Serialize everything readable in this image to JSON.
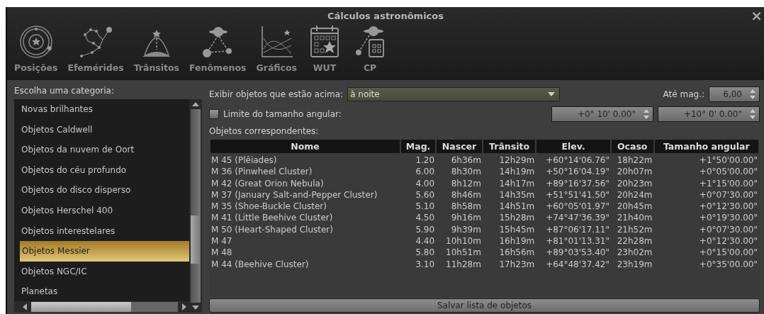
{
  "window": {
    "title": "Cálculos astronômicos",
    "close": "×"
  },
  "tabs": [
    {
      "label": "Posições",
      "selected": false
    },
    {
      "label": "Efemérides",
      "selected": false
    },
    {
      "label": "Trânsitos",
      "selected": false
    },
    {
      "label": "Fenômenos",
      "selected": false
    },
    {
      "label": "Gráficos",
      "selected": false
    },
    {
      "label": "WUT",
      "selected": false
    },
    {
      "label": "CP",
      "selected": false
    }
  ],
  "sidebar": {
    "label": "Escolha uma categoria:",
    "items": [
      {
        "label": "Novas brilhantes",
        "selected": false
      },
      {
        "label": "Objetos Caldwell",
        "selected": false
      },
      {
        "label": "Objetos da nuvem de Oort",
        "selected": false
      },
      {
        "label": "Objetos do céu profundo",
        "selected": false
      },
      {
        "label": "Objetos do disco disperso",
        "selected": false
      },
      {
        "label": "Objetos Herschel 400",
        "selected": false
      },
      {
        "label": "Objetos interestelares",
        "selected": false
      },
      {
        "label": "Objetos Messier",
        "selected": true
      },
      {
        "label": "Objetos NGC/IC",
        "selected": false
      },
      {
        "label": "Planetas",
        "selected": false
      }
    ]
  },
  "filters": {
    "above_label": "Exibir objetos que estão acima:",
    "above_value": "à noite",
    "mag_label": "Até mag.:",
    "mag_value": "6,00",
    "size_limit": {
      "label": "Limite do tamanho angular:",
      "checked": false,
      "min": "+0° 10' 0.00\"",
      "max": "+10° 0' 0.00\""
    }
  },
  "table": {
    "label": "Objetos correspondentes:",
    "columns": [
      "Nome",
      "Mag.",
      "Nascer",
      "Trânsito",
      "Elev.",
      "Ocaso",
      "Tamanho angular"
    ],
    "rows": [
      [
        "M 45 (Plêiades)",
        "1.20",
        "6h36m",
        "12h29m",
        "+60°14'06.76\"",
        "18h22m",
        "+1°50'00.00\""
      ],
      [
        "M 36 (Pinwheel Cluster)",
        "6.00",
        "8h30m",
        "14h19m",
        "+50°16'04.19\"",
        "20h07m",
        "+0°05'00.00\""
      ],
      [
        "M 42 (Great Orion Nebula)",
        "4.00",
        "8h12m",
        "14h17m",
        "+89°16'37.56\"",
        "20h23m",
        "+1°15'00.00\""
      ],
      [
        "M 37 (January Salt-and-Pepper Cluster)",
        "5.60",
        "8h46m",
        "14h35m",
        "+51°51'41.50\"",
        "20h24m",
        "+0°07'30.00\""
      ],
      [
        "M 35 (Shoe-Buckle Cluster)",
        "5.10",
        "8h58m",
        "14h51m",
        "+60°05'01.97\"",
        "20h45m",
        "+0°12'30.00\""
      ],
      [
        "M 41 (Little Beehive Cluster)",
        "4.50",
        "9h16m",
        "15h28m",
        "+74°47'36.39\"",
        "21h40m",
        "+0°19'30.00\""
      ],
      [
        "M 50 (Heart-Shaped Cluster)",
        "5.90",
        "9h39m",
        "15h45m",
        "+87°06'17.11\"",
        "21h52m",
        "+0°07'30.00\""
      ],
      [
        "M 47",
        "4.40",
        "10h10m",
        "16h19m",
        "+81°01'13.31\"",
        "22h28m",
        "+0°12'30.00\""
      ],
      [
        "M 48",
        "5.80",
        "10h51m",
        "16h56m",
        "+89°03'53.40\"",
        "23h02m",
        "+0°15'00.00\""
      ],
      [
        "M 44 (Beehive Cluster)",
        "3.10",
        "11h28m",
        "17h23m",
        "+64°48'37.42\"",
        "23h19m",
        "+0°35'00.00\""
      ]
    ]
  },
  "save_button": "Salvar lista de objetos"
}
